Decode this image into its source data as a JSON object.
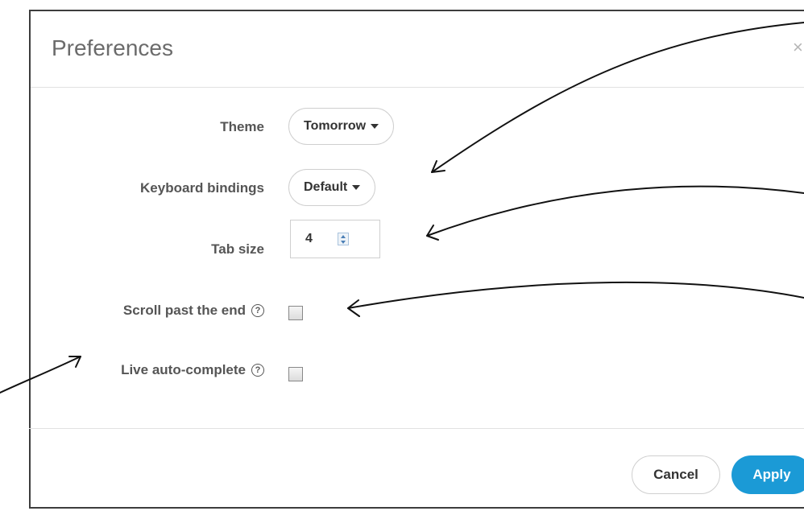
{
  "dialog": {
    "title": "Preferences",
    "close_glyph": "×"
  },
  "settings": {
    "theme": {
      "label": "Theme",
      "value": "Tomorrow"
    },
    "keyboard_bindings": {
      "label": "Keyboard bindings",
      "value": "Default"
    },
    "tab_size": {
      "label": "Tab size",
      "value": "4"
    },
    "scroll_past_end": {
      "label": "Scroll past the end",
      "help": "?",
      "checked": false
    },
    "live_autocomplete": {
      "label": "Live auto-complete",
      "help": "?",
      "checked": false
    }
  },
  "footer": {
    "cancel_label": "Cancel",
    "apply_label": "Apply"
  },
  "colors": {
    "accent": "#1b9ad6",
    "annotation": "#111111"
  },
  "icons": [
    "close-icon",
    "help-icon",
    "caret-down-icon",
    "spinner-icon"
  ]
}
